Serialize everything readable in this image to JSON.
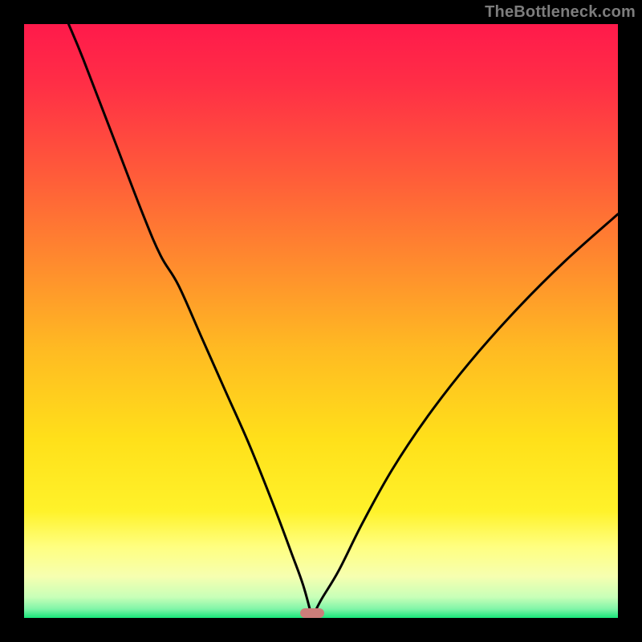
{
  "watermark": "TheBottleneck.com",
  "gradient_stops": [
    {
      "offset": 0,
      "color": "#ff1a4b"
    },
    {
      "offset": 0.1,
      "color": "#ff2e46"
    },
    {
      "offset": 0.25,
      "color": "#ff5a3a"
    },
    {
      "offset": 0.4,
      "color": "#ff8a2e"
    },
    {
      "offset": 0.55,
      "color": "#ffbb22"
    },
    {
      "offset": 0.7,
      "color": "#ffe01a"
    },
    {
      "offset": 0.82,
      "color": "#fff22a"
    },
    {
      "offset": 0.88,
      "color": "#ffff80"
    },
    {
      "offset": 0.93,
      "color": "#f6ffb0"
    },
    {
      "offset": 0.965,
      "color": "#c8ffb8"
    },
    {
      "offset": 0.985,
      "color": "#80f5a8"
    },
    {
      "offset": 1.0,
      "color": "#18e67a"
    }
  ],
  "marker": {
    "x_norm": 0.485
  },
  "chart_data": {
    "type": "line",
    "title": "",
    "xlabel": "",
    "ylabel": "",
    "xlim": [
      0,
      1
    ],
    "ylim": [
      0,
      1
    ],
    "series": [
      {
        "name": "bottleneck-curve",
        "x": [
          0.075,
          0.1,
          0.15,
          0.2,
          0.23,
          0.26,
          0.3,
          0.34,
          0.38,
          0.42,
          0.45,
          0.47,
          0.485,
          0.5,
          0.53,
          0.57,
          0.62,
          0.68,
          0.75,
          0.83,
          0.91,
          1.0
        ],
        "y": [
          1.0,
          0.94,
          0.81,
          0.68,
          0.61,
          0.56,
          0.47,
          0.38,
          0.29,
          0.19,
          0.11,
          0.055,
          0.0,
          0.03,
          0.08,
          0.16,
          0.25,
          0.34,
          0.43,
          0.52,
          0.6,
          0.68
        ]
      }
    ]
  }
}
